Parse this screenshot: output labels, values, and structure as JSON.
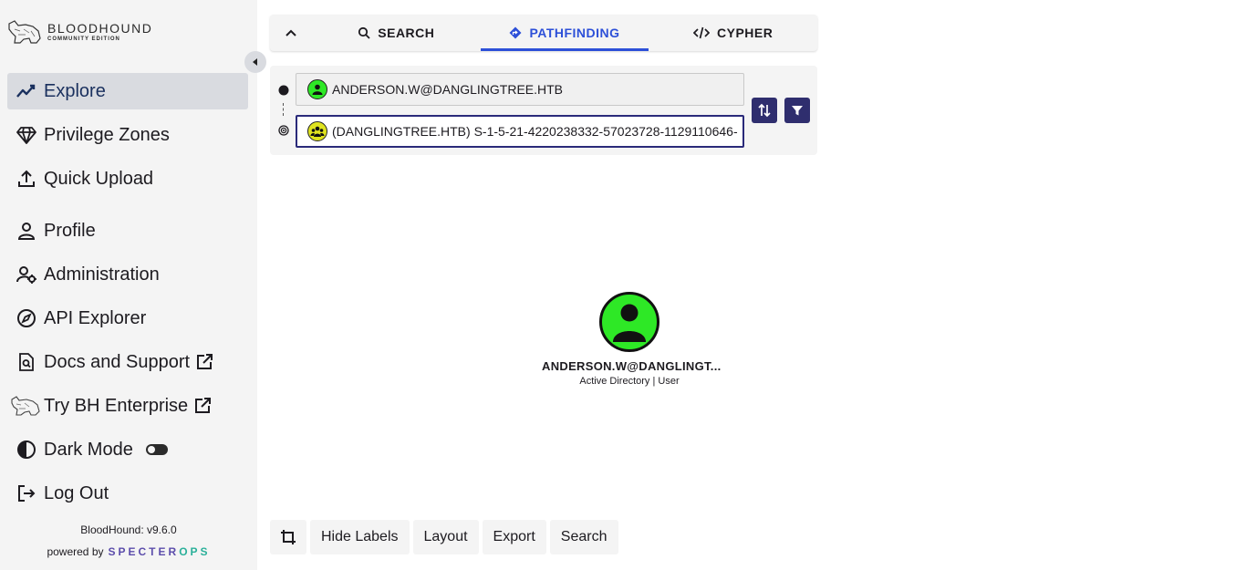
{
  "logo": {
    "brand": "BLOODHOUND",
    "edition": "COMMUNITY EDITION"
  },
  "sidebar": {
    "items": [
      {
        "label": "Explore",
        "icon": "chart-line-icon",
        "active": true
      },
      {
        "label": "Privilege Zones",
        "icon": "gem-icon"
      },
      {
        "label": "Quick Upload",
        "icon": "upload-icon"
      },
      {
        "label": "Profile",
        "icon": "person-icon"
      },
      {
        "label": "Administration",
        "icon": "user-cog-icon"
      },
      {
        "label": "API Explorer",
        "icon": "compass-icon"
      },
      {
        "label": "Docs and Support",
        "icon": "doc-search-icon"
      },
      {
        "label": "Try BH Enterprise",
        "icon": "bloodhound-dog-icon"
      },
      {
        "label": "Dark Mode",
        "icon": "half-circle-icon"
      },
      {
        "label": "Log Out",
        "icon": "logout-icon"
      }
    ],
    "version": "BloodHound: v9.6.0",
    "powered_by": "powered by",
    "specter": "SPECTER",
    "ops": "OPS"
  },
  "tabs": {
    "search": "SEARCH",
    "pathfinding": "PATHFINDING",
    "cypher": "CYPHER",
    "active": "pathfinding"
  },
  "pathfinding": {
    "start_value": "ANDERSON.W@DANGLINGTREE.HTB",
    "destination_value": "(DANGLINGTREE.HTB) S-1-5-21-4220238332-57023728-1129110646-"
  },
  "graph": {
    "node_label": "ANDERSON.W@DANGLINGT...",
    "node_subtitle": "Active Directory | User",
    "node_color": "#2ee826"
  },
  "toolbar": {
    "hide_labels": "Hide Labels",
    "layout": "Layout",
    "export": "Export",
    "search": "Search"
  },
  "colors": {
    "accent": "#2d50d8",
    "button_dark": "#2f2e6e",
    "user_green": "#2ee826",
    "group_yellow": "#dfe31f"
  }
}
